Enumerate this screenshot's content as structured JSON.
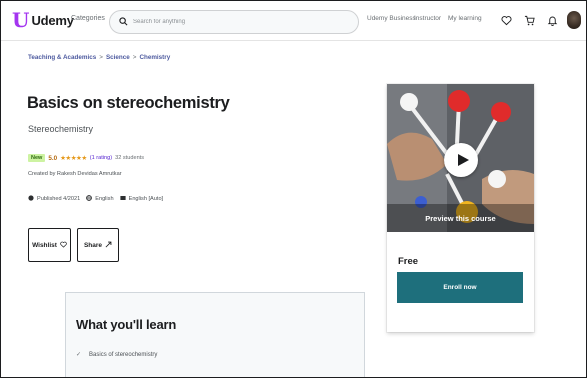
{
  "header": {
    "logo_mark": "U",
    "logo_text": "Udemy",
    "categories_label": "Categories",
    "search_placeholder": "Search for anything",
    "udemy_business": "Udemy Business",
    "instructor": "Instructor",
    "my_learning": "My learning"
  },
  "breadcrumb": {
    "items": [
      "Teaching & Academics",
      "Science",
      "Chemistry"
    ],
    "separator": ">"
  },
  "course": {
    "title": "Basics on stereochemistry",
    "subtitle": "Stereochemistry",
    "badge": "New",
    "rating_value": "5.0",
    "stars": "★★★★★",
    "rating_count": "(1 rating)",
    "students": "32 students",
    "created_by": "Created by Rakesh Devidas Amrutkar",
    "published": "Published 4/2021",
    "language": "English",
    "captions": "English [Auto]"
  },
  "actions": {
    "wishlist_label": "Wishlist",
    "share_label": "Share"
  },
  "learn": {
    "title": "What you'll learn",
    "items": [
      "Basics of stereochemistry"
    ]
  },
  "sidebar": {
    "preview_label": "Preview this course",
    "price": "Free",
    "enroll_label": "Enroll now"
  },
  "colors": {
    "brand": "#a435f0",
    "enroll_button": "#1e6f7c",
    "badge_bg": "#cdf3a2",
    "rating": "#b4690e",
    "link": "#4d5a9f"
  },
  "icons": [
    "search-icon",
    "heart-icon",
    "cart-icon",
    "bell-icon",
    "globe-icon",
    "captions-icon",
    "share-icon",
    "play-icon",
    "check-icon"
  ]
}
